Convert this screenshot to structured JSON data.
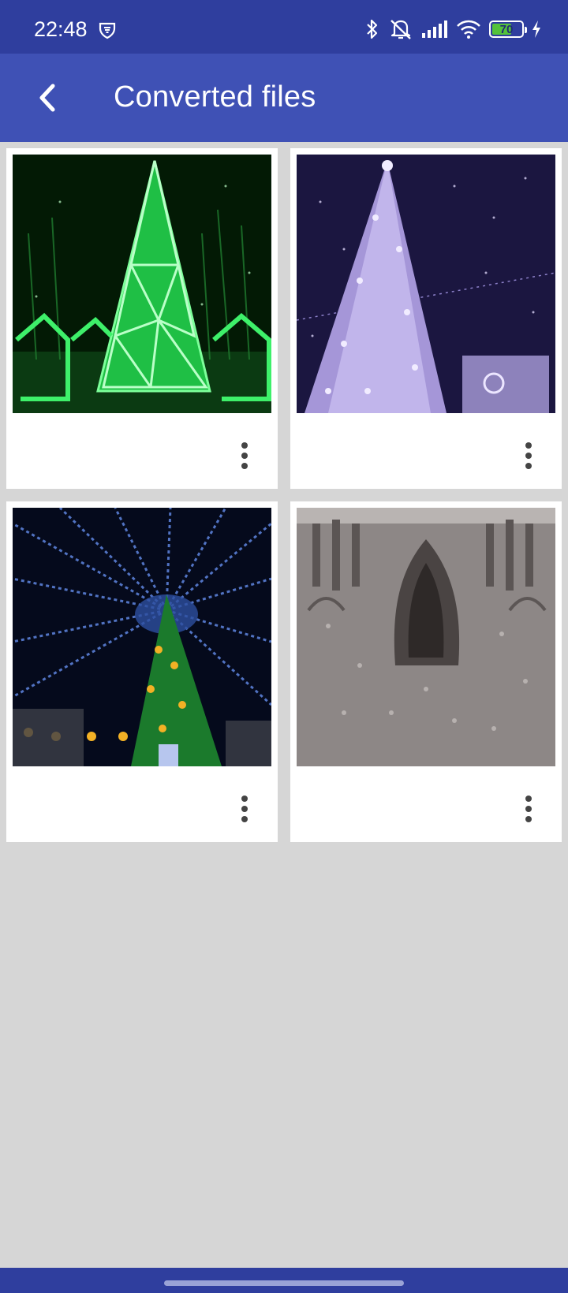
{
  "status_bar": {
    "time": "22:48",
    "battery_level": "70",
    "battery_fraction": 0.7,
    "icons": [
      "vpn-shield-icon",
      "bluetooth-icon",
      "silent-bell-icon",
      "cellular-signal-icon",
      "wifi-icon",
      "battery-icon",
      "charging-icon"
    ]
  },
  "app_bar": {
    "title": "Converted files",
    "back_icon": "chevron-left-icon",
    "background": "#3f51b5"
  },
  "files": [
    {
      "thumbnail": "green neon christmas tree",
      "menu_icon": "more-vertical-icon"
    },
    {
      "thumbnail": "purple lit christmas tree",
      "menu_icon": "more-vertical-icon"
    },
    {
      "thumbnail": "christmas tree with blue radial lights",
      "menu_icon": "more-vertical-icon"
    },
    {
      "thumbnail": "gray cathedral facade",
      "menu_icon": "more-vertical-icon"
    }
  ],
  "colors": {
    "status_bar": "#2f3e9e",
    "app_bar": "#3f51b5",
    "background": "#d6d6d6",
    "card": "#ffffff"
  }
}
